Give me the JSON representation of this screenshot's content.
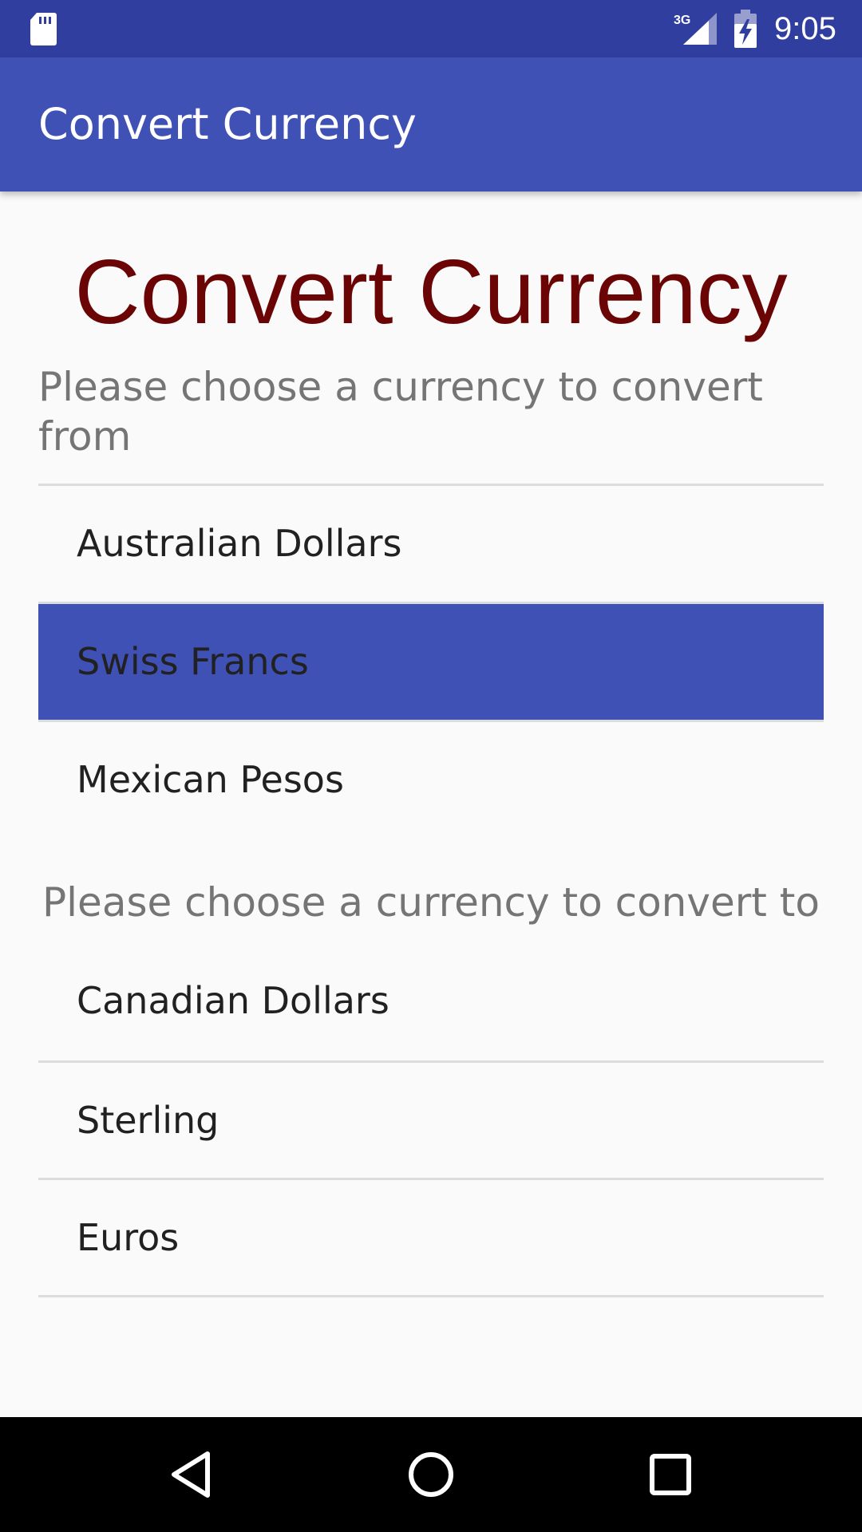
{
  "status_bar": {
    "time": "9:05",
    "network_type": "3G",
    "icons": [
      "sd-card-icon",
      "signal-icon",
      "battery-charging-icon"
    ]
  },
  "app_bar": {
    "title": "Convert Currency"
  },
  "main": {
    "heading": "Convert Currency",
    "from_prompt": "Please choose a currency to convert from",
    "to_prompt": "Please choose a currency to convert to",
    "from_list": [
      {
        "label": "Australian Dollars",
        "selected": false
      },
      {
        "label": "Swiss Francs",
        "selected": true
      },
      {
        "label": "Mexican Pesos",
        "selected": false
      }
    ],
    "to_list": [
      {
        "label": "Canadian Dollars",
        "selected": false
      },
      {
        "label": "Sterling",
        "selected": false
      },
      {
        "label": "Euros",
        "selected": false
      }
    ]
  },
  "nav_bar": {
    "buttons": [
      "back-icon",
      "home-icon",
      "recents-icon"
    ]
  },
  "colors": {
    "status_bar": "#303F9F",
    "app_bar": "#3F51B5",
    "selected_item": "#3F51B5",
    "heading": "#6B0505",
    "prompt_text": "#757575",
    "item_text": "#212121",
    "background": "#FAFAFA"
  }
}
